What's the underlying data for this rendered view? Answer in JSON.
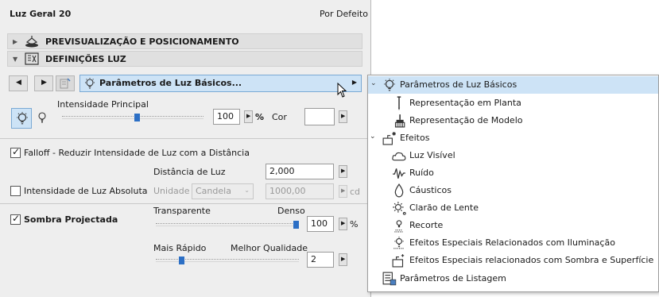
{
  "panel": {
    "title": "Luz Geral 20",
    "preset": "Por Defeito",
    "sections": {
      "preview": "PREVISUALIZAÇÃO E POSICIONAMENTO",
      "light_settings": "DEFINIÇÕES LUZ"
    },
    "page_selector": "Parâmetros de Luz Básicos...",
    "intensity": {
      "label": "Intensidade Principal",
      "value": "100",
      "unit": "%",
      "slider_level_percent": 53,
      "color_label": "Cor"
    },
    "falloff": {
      "label": "Falloff - Reduzir Intensidade de Luz com a Distância",
      "checked": true,
      "distance_label": "Distância de Luz",
      "distance_value": "2,000"
    },
    "absolute": {
      "label": "Intensidade de Luz Absoluta",
      "checked": false,
      "unit_label": "Unidade",
      "unit_value": "Candela",
      "value": "1000,00",
      "unit_suffix": "cd"
    },
    "shadow": {
      "label": "Sombra Projectada",
      "checked": true,
      "transparent_label": "Transparente",
      "dense_label": "Denso",
      "density_value": "100",
      "density_unit": "%",
      "density_slider_percent": 100,
      "fast_label": "Mais Rápido",
      "quality_label": "Melhor Qualidade",
      "quality_value": "2",
      "quality_slider_percent": 17
    }
  },
  "menu": {
    "items": [
      {
        "label": "Parâmetros de Luz Básicos",
        "icon": "bulb-icon",
        "selected": true,
        "expandable": true
      },
      {
        "label": "Representação em Planta",
        "icon": "pin-icon"
      },
      {
        "label": "Representação de Modelo",
        "icon": "brush-icon"
      },
      {
        "label": "Efeitos",
        "icon": "effects-icon",
        "expandable": true
      },
      {
        "label": "Luz Visível",
        "icon": "cloud-icon"
      },
      {
        "label": "Ruído",
        "icon": "noise-icon"
      },
      {
        "label": "Cáusticos",
        "icon": "drop-icon"
      },
      {
        "label": "Clarão de Lente",
        "icon": "flare-icon"
      },
      {
        "label": "Recorte",
        "icon": "cutout-icon"
      },
      {
        "label": "Efeitos Especiais Relacionados com Iluminação",
        "icon": "special-light-icon"
      },
      {
        "label": "Efeitos Especiais relacionados com Sombra e Superfície",
        "icon": "special-shadow-icon"
      },
      {
        "label": "Parâmetros de Listagem",
        "icon": "listing-icon"
      }
    ]
  },
  "colors": {
    "selection": "#cde3f6",
    "slider_thumb": "#2c6fc5",
    "panel_bg": "#eeeeee"
  }
}
